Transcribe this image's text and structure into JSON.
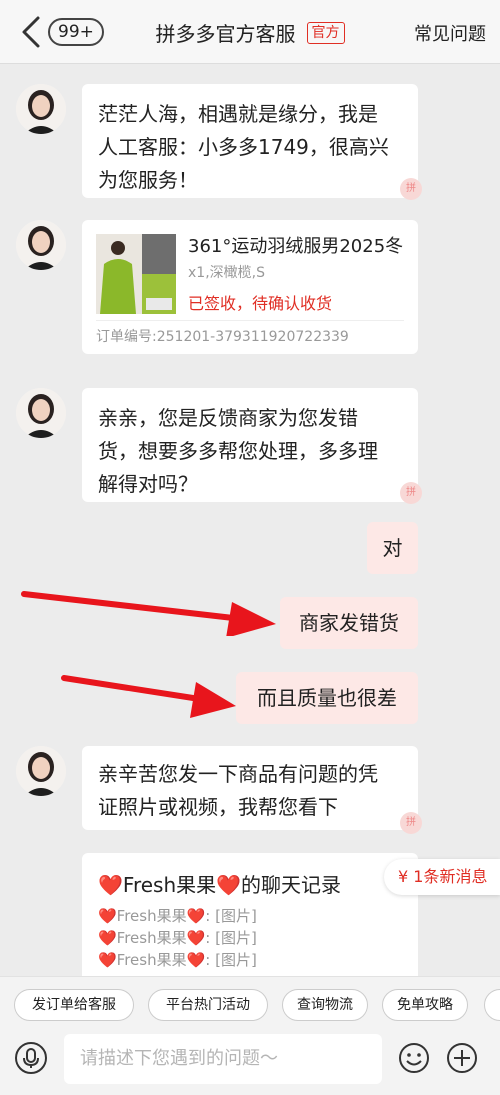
{
  "header": {
    "unread_badge": "99+",
    "title": "拼多多官方客服",
    "tag": "官方",
    "faq": "常见问题"
  },
  "messages": {
    "welcome_lines": [
      "茫茫人海，相遇就是缘分，我是",
      "人工客服：小多多1749，很高兴",
      "为您服务！"
    ],
    "order": {
      "title": "361°运动羽绒服男2025冬",
      "spec": "x1,深橄榄,S",
      "status": "已签收，待确认收货",
      "order_no": "订单编号:251201-379311920722339"
    },
    "confirm_lines": [
      "亲亲，您是反馈商家为您发错",
      "货，想要多多帮您处理，多多理",
      "解得对吗？"
    ],
    "user_reply_1": "对",
    "user_reply_2": "商家发错货",
    "user_reply_3": "而且质量也很差",
    "request_lines": [
      "亲辛苦您发一下商品有问题的凭",
      "证照片或视频，我帮您看下"
    ],
    "record": {
      "title": "❤️Fresh果果❤️的聊天记录",
      "lines": [
        "❤️Fresh果果❤️: [图片]",
        "❤️Fresh果果❤️: [图片]",
        "❤️Fresh果果❤️: [图片]"
      ]
    },
    "stamp_text": "拼"
  },
  "new_message": "¥ 1条新消息",
  "quick_actions": [
    "发订单给客服",
    "平台热门活动",
    "查询物流",
    "免单攻略"
  ],
  "input": {
    "placeholder": "请描述下您遇到的问题～"
  },
  "colors": {
    "brand_red": "#e02e24",
    "user_bubble": "#fde8e6",
    "arrow_red": "#e8151c"
  }
}
